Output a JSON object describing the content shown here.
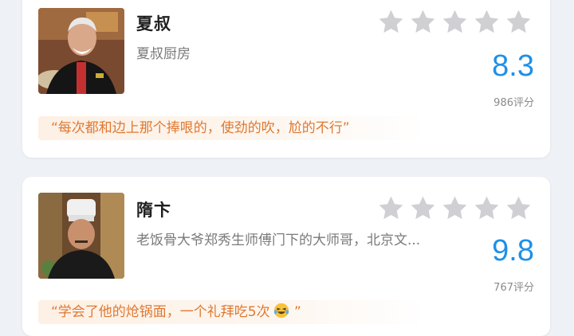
{
  "cards": [
    {
      "name": "夏叔",
      "subtitle": "夏叔厨房",
      "stars": 5,
      "score": "8.3",
      "count": "986评分",
      "quote_text": "“每次都和边上那个捧哏的，使劲的吹，尬的不行”",
      "quote_emoji": ""
    },
    {
      "name": "隋卞",
      "subtitle": "老饭骨大爷郑秀生师傅门下的大师哥，北京文...",
      "stars": 5,
      "score": "9.8",
      "count": "767评分",
      "quote_text": "“学会了他的炝锅面，一个礼拜吃5次",
      "quote_emoji": "laughing-tears-emoji",
      "quote_tail": " ”"
    }
  ],
  "colors": {
    "score": "#1e90e8",
    "quote_text": "#e07830",
    "quote_bg": "#fdf0e4",
    "star": "#cfcfd4"
  }
}
